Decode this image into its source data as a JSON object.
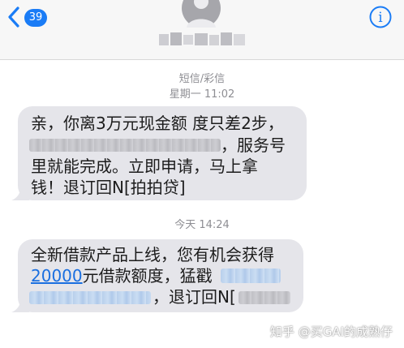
{
  "nav": {
    "back_count": "39",
    "info_glyph": "i",
    "icons": {
      "back": "chevron-left-icon",
      "avatar": "person-avatar-icon",
      "info": "info-circle-icon"
    }
  },
  "thread": {
    "channel": "短信/彩信",
    "first_time": "星期一 11:02",
    "second_time": "今天 14:24"
  },
  "messages": [
    {
      "lines": [
        "亲，你离3万元现金额 度只差2步，",
        "，服务号",
        "里就能完成。立即申请，马上拿",
        "钱！退订回N[拍拍贷]"
      ]
    },
    {
      "lines": [
        "全新借款产品上线，您有机会获得",
        "元借款额度，猛戳",
        "，退订回N["
      ],
      "link_amount": "20000"
    }
  ],
  "watermark": "知乎 @买GAI的成熟仔",
  "colors": {
    "accent": "#1a7cf6",
    "bubble": "#e5e5ea",
    "link": "#1a6fe0"
  }
}
